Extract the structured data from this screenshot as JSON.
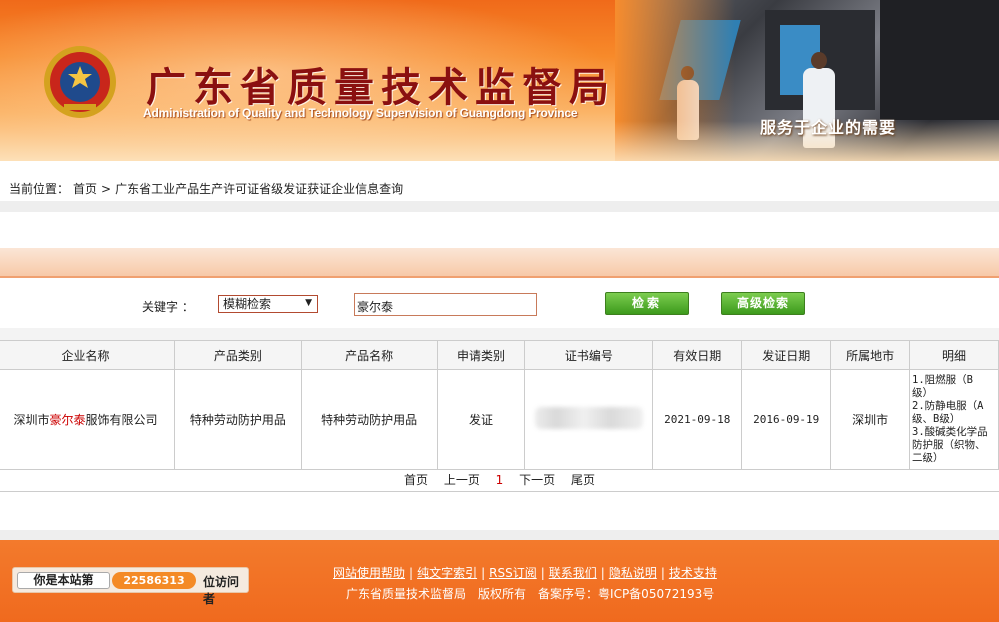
{
  "header": {
    "title_cn": "广东省质量技术监督局",
    "title_en": "Administration of Quality and Technology Supervision of Guangdong Province",
    "slogan": "服务于企业的需要",
    "brand_color": "#f06a1a"
  },
  "breadcrumb": {
    "prefix": "当前位置：",
    "home": "首页",
    "separator": ">",
    "current": "广东省工业产品生产许可证省级发证获证企业信息查询"
  },
  "search": {
    "keyword_label": "关键字 ：",
    "mode_selected": "模糊检索",
    "keyword_value": "豪尔泰",
    "search_button": "检索",
    "advanced_button": "高级检索"
  },
  "table": {
    "columns": [
      "企业名称",
      "产品类别",
      "产品名称",
      "申请类别",
      "证书编号",
      "有效日期",
      "发证日期",
      "所属地市",
      "明细"
    ],
    "rows": [
      {
        "company_prefix": "深圳市",
        "company_highlight": "豪尔泰",
        "company_suffix": "服饰有限公司",
        "product_category": "特种劳动防护用品",
        "product_name": "特种劳动防护用品",
        "apply_type": "发证",
        "cert_no": "",
        "valid_date": "2021-09-18",
        "issue_date": "2016-09-19",
        "city": "深圳市",
        "detail_lines": [
          "1.阻燃服（B",
          "级）",
          "2.防静电服（A",
          "级、B级）",
          "3.酸碱类化学品",
          "防护服（织物、",
          "二级）"
        ]
      }
    ]
  },
  "pager": {
    "first": "首页",
    "prev": "上一页",
    "current": "1",
    "next": "下一页",
    "last": "尾页"
  },
  "footer": {
    "counter_label": "你是本站第",
    "counter_value": "22586313",
    "counter_suffix": "位访问者",
    "links": [
      "网站使用帮助",
      "纯文字索引",
      "RSS订阅",
      "联系我们",
      "隐私说明",
      "技术支持"
    ],
    "link_separator": "|",
    "org": "广东省质量技术监督局",
    "rights": "版权所有",
    "icp": "备案序号：粤ICP备05072193号"
  }
}
